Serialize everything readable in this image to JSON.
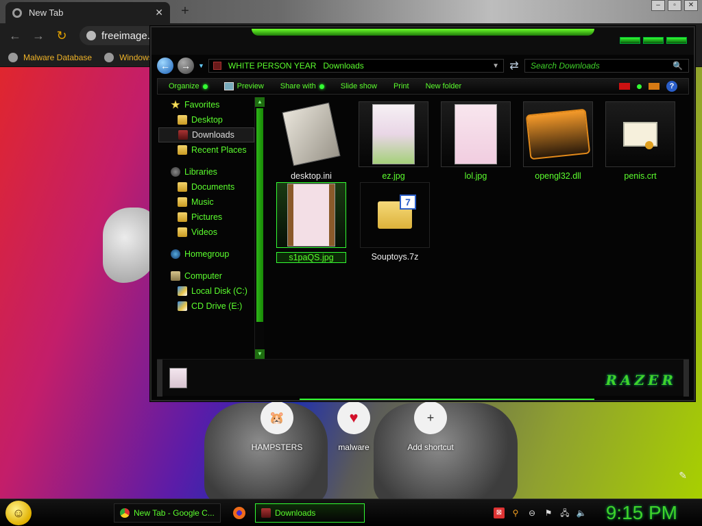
{
  "browser": {
    "tab_title": "New Tab",
    "omnibox_text": "freeimage.ho",
    "bookmarks": [
      "Malware Database",
      "Windows"
    ],
    "shortcuts": [
      {
        "label": "HAMPSTERS",
        "icon": "hamster-icon"
      },
      {
        "label": "malware",
        "icon": "heart-icon"
      },
      {
        "label": "Add shortcut",
        "icon": "plus-icon"
      }
    ]
  },
  "explorer": {
    "breadcrumb": [
      "WHITE PERSON YEAR",
      "Downloads"
    ],
    "search_placeholder": "Search Downloads",
    "commands": [
      "Organize",
      "Preview",
      "Share with",
      "Slide show",
      "Print",
      "New folder"
    ],
    "nav": {
      "favorites": "Favorites",
      "favorites_items": [
        "Desktop",
        "Downloads",
        "Recent Places"
      ],
      "libraries": "Libraries",
      "libraries_items": [
        "Documents",
        "Music",
        "Pictures",
        "Videos"
      ],
      "homegroup": "Homegroup",
      "computer": "Computer",
      "computer_items": [
        "Local Disk (C:)",
        "CD Drive (E:)"
      ]
    },
    "files": [
      "desktop.ini",
      "ez.jpg",
      "lol.jpg",
      "opengl32.dll",
      "penis.crt",
      "s1paQS.jpg",
      "Souptoys.7z"
    ],
    "logo_text": "RAZER"
  },
  "taskbar": {
    "tasks": [
      "New Tab - Google C...",
      "Downloads"
    ],
    "clock": "9:15 PM"
  }
}
